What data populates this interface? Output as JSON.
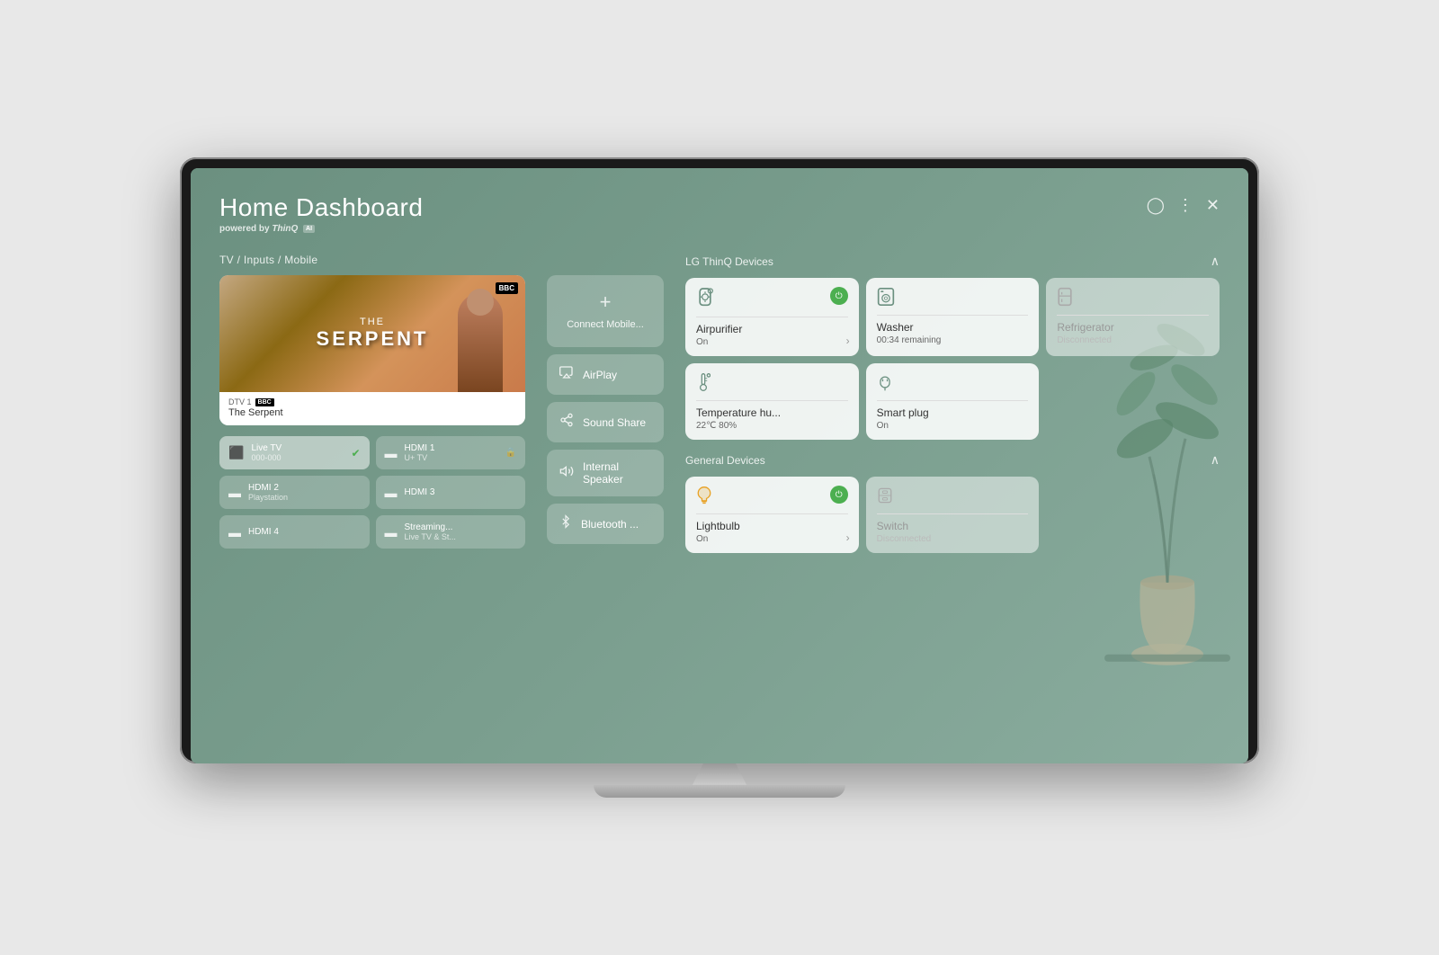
{
  "header": {
    "title": "Home Dashboard",
    "subtitle": "powered by",
    "brand": "ThinQ",
    "ai_badge": "AI"
  },
  "sections": {
    "tv_inputs": "TV / Inputs / Mobile",
    "thinq_devices": "LG ThinQ Devices",
    "general_devices": "General Devices"
  },
  "tv_preview": {
    "channel": "DTV 1",
    "channel_logo": "BBC",
    "show_name": "The Serpent",
    "show_the": "THE",
    "show_serpent": "SERPENT"
  },
  "inputs": [
    {
      "id": "live-tv",
      "name": "Live TV",
      "sub": "000-000",
      "active": true,
      "icon": "📺"
    },
    {
      "id": "hdmi1",
      "name": "HDMI 1",
      "sub": "U+ TV",
      "active": false,
      "locked": true,
      "icon": "▬"
    },
    {
      "id": "hdmi2",
      "name": "HDMI 2",
      "sub": "Playstation",
      "active": false,
      "icon": "▬"
    },
    {
      "id": "hdmi3",
      "name": "HDMI 3",
      "sub": "",
      "active": false,
      "icon": "▬"
    },
    {
      "id": "hdmi4",
      "name": "HDMI 4",
      "sub": "",
      "active": false,
      "icon": "▬"
    },
    {
      "id": "streaming",
      "name": "Streaming...",
      "sub": "Live TV & St...",
      "active": false,
      "icon": "▬"
    }
  ],
  "mobile_features": [
    {
      "id": "connect-mobile",
      "label": "Connect Mobile...",
      "type": "plus"
    },
    {
      "id": "airplay",
      "label": "AirPlay",
      "icon": "airplay"
    },
    {
      "id": "sound-share",
      "label": "Sound Share",
      "icon": "sound"
    },
    {
      "id": "internal-speaker",
      "label": "Internal Speaker",
      "icon": "speaker"
    },
    {
      "id": "bluetooth",
      "label": "Bluetooth ...",
      "icon": "bluetooth"
    }
  ],
  "thinq_devices": [
    {
      "id": "airpurifier",
      "name": "Airpurifier",
      "status": "On",
      "icon": "air",
      "power": true,
      "has_arrow": true
    },
    {
      "id": "washer",
      "name": "Washer",
      "status": "00:34 remaining",
      "icon": "washer",
      "power": false,
      "has_arrow": false
    },
    {
      "id": "refrigerator",
      "name": "Refrigerator",
      "status": "Disconnected",
      "icon": "fridge",
      "power": false,
      "has_arrow": false,
      "dimmed": true
    },
    {
      "id": "temperature",
      "name": "Temperature hu...",
      "status": "22℃ 80%",
      "icon": "temp",
      "power": false,
      "has_arrow": false
    },
    {
      "id": "smart-plug",
      "name": "Smart plug",
      "status": "On",
      "icon": "plug",
      "power": false,
      "has_arrow": false
    }
  ],
  "general_devices": [
    {
      "id": "lightbulb",
      "name": "Lightbulb",
      "status": "On",
      "icon": "bulb",
      "power": true,
      "has_arrow": true
    },
    {
      "id": "switch",
      "name": "Switch",
      "status": "Disconnected",
      "icon": "switch",
      "power": false,
      "has_arrow": false,
      "dimmed": true
    }
  ],
  "colors": {
    "bg": "#6b9080",
    "card_bg": "rgba(255,255,255,0.88)",
    "power_on": "#4caf50",
    "text_primary": "#fff",
    "text_dark": "#333"
  }
}
